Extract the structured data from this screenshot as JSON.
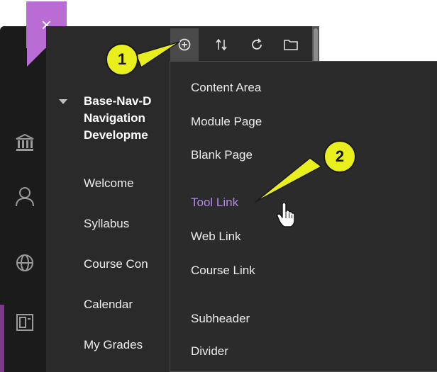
{
  "close_button": {
    "glyph": "×"
  },
  "course": {
    "title_lines": [
      "Base-Nav-D",
      "Navigation",
      "Developme"
    ],
    "nav_items": [
      "Welcome",
      "Syllabus",
      "Course Con",
      "Calendar",
      "My Grades"
    ]
  },
  "add_menu": {
    "items": [
      "Content Area",
      "Module Page",
      "Blank Page",
      "Tool Link",
      "Web Link",
      "Course Link",
      "Subheader",
      "Divider"
    ],
    "highlighted": "Tool Link"
  },
  "callouts": [
    {
      "number": "1",
      "points_to": "add-menu-item-icon"
    },
    {
      "number": "2",
      "points_to": "Tool Link"
    }
  ],
  "colors": {
    "rail": "#1b1b1b",
    "panel": "#2a2a2a",
    "close_accent": "#b96cd4",
    "callout": "#e9ef1c",
    "highlight_text": "#b58be0"
  },
  "icons": [
    "plus-circle-icon",
    "sort-arrows-icon",
    "refresh-icon",
    "folder-icon",
    "institution-icon",
    "user-icon",
    "globe-icon",
    "courses-icon",
    "hand-pointer-icon"
  ]
}
